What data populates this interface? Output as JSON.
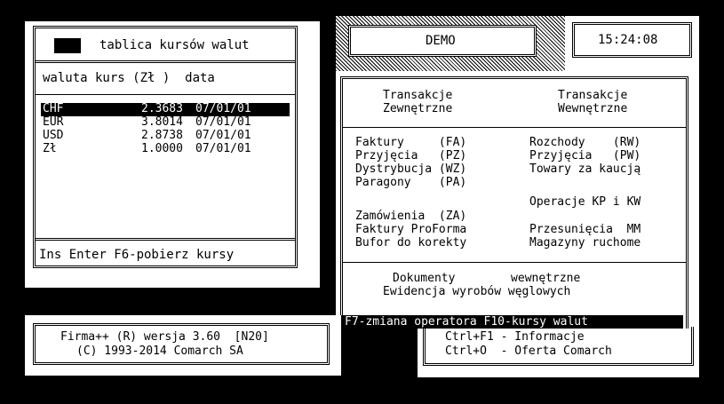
{
  "rates_window": {
    "title": "tablica kursów walut",
    "header": "waluta kurs (Zł )  data",
    "rows": [
      {
        "code": "CHF",
        "rate": "2.3683",
        "date": "07/01/01"
      },
      {
        "code": "EUR",
        "rate": "3.8014",
        "date": "07/01/01"
      },
      {
        "code": "USD",
        "rate": "2.8738",
        "date": "07/01/01"
      },
      {
        "code": "Zł",
        "rate": "1.0000",
        "date": "07/01/01"
      }
    ],
    "footer": "Ins Enter F6-pobierz kursy"
  },
  "demo_label": "DEMO",
  "clock": "15:24:08",
  "menu": {
    "ext_header_1": "Transakcje",
    "ext_header_2": "Zewnętrzne",
    "int_header_1": "Transakcje",
    "int_header_2": "Wewnętrzne",
    "left_items": [
      "Faktury     (FA)",
      "Przyjęcia   (PZ)",
      "Dystrybucja (WZ)",
      "Paragony    (PA)",
      "Zamówienia  (ZA)",
      "Faktury ProForma",
      "Bufor do korekty"
    ],
    "right_items": [
      "Rozchody    (RW)",
      "Przyjęcia   (PW)",
      "Towary za kaucją",
      "Operacje KP i KW",
      "Przesunięcia  MM",
      "Magazyny ruchome"
    ],
    "bottom_line_1": "Dokumenty        wewnętrzne",
    "bottom_line_2": "Ewidencja wyrobów węglowych",
    "status_bar": "F7-zmiana operatora F10-kursy walut"
  },
  "about": {
    "line1": "Firma++ (R) wersja 3.60  [N20]",
    "line2": "(C) 1993-2014 Comarch SA"
  },
  "shortcuts": {
    "line1": "Ctrl+F1 - Informacje",
    "line2": "Ctrl+O  - Oferta Comarch"
  }
}
